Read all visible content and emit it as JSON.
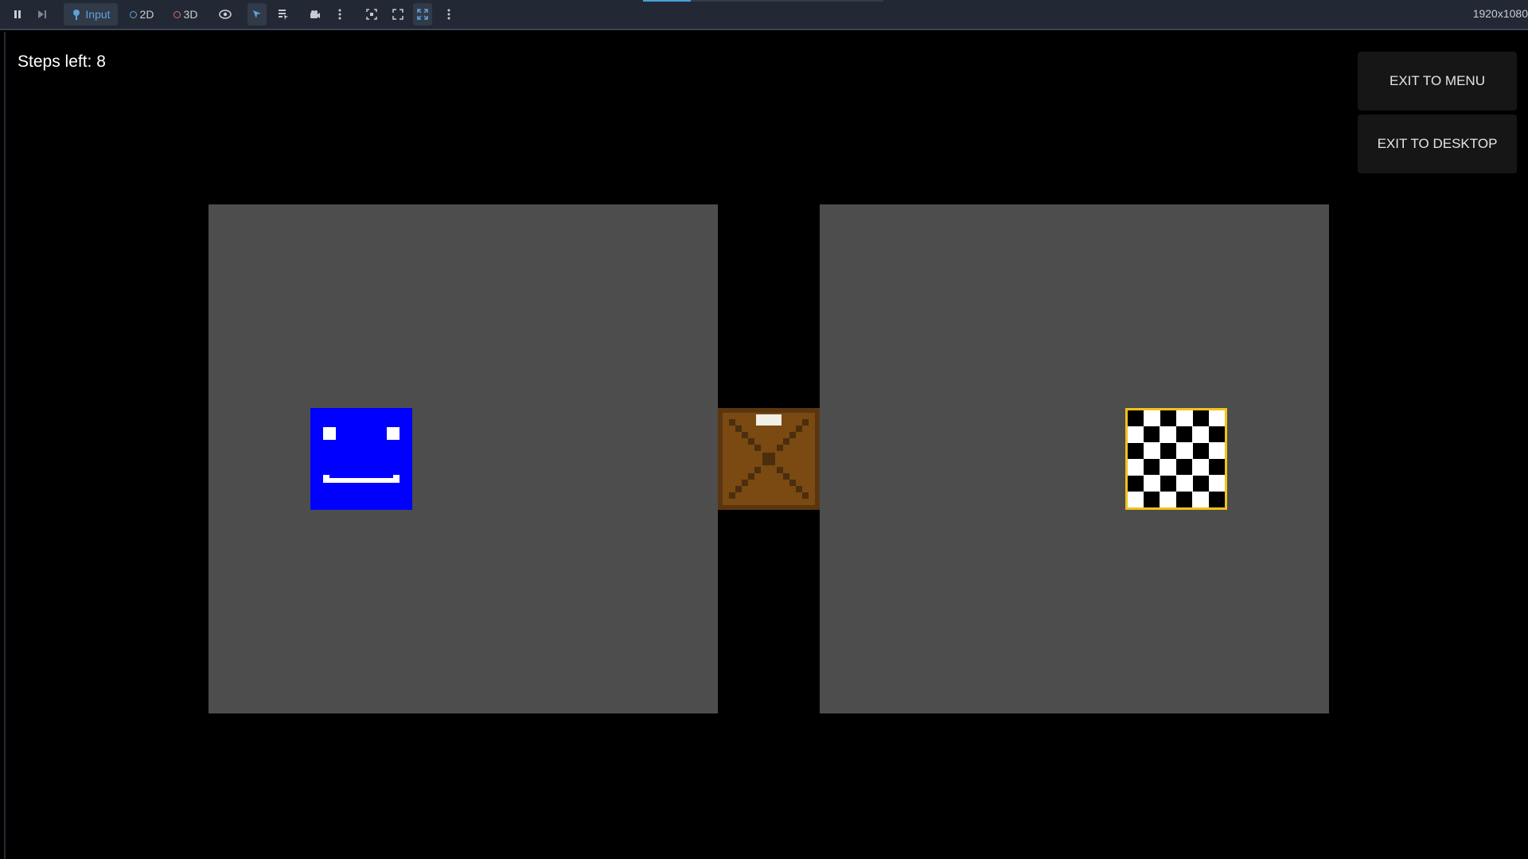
{
  "toolbar": {
    "input_label": "Input",
    "mode_2d_label": "2D",
    "mode_3d_label": "3D",
    "resolution": "1920x1080"
  },
  "hud": {
    "steps_left": "Steps left: 8"
  },
  "menu": {
    "exit_to_menu": "EXIT TO MENU",
    "exit_to_desktop": "EXIT TO DESKTOP"
  },
  "colors": {
    "room": "#4d4d4d",
    "player": "#0000ff",
    "crate": "#7a4a12",
    "goal_border": "#f2c21b"
  }
}
